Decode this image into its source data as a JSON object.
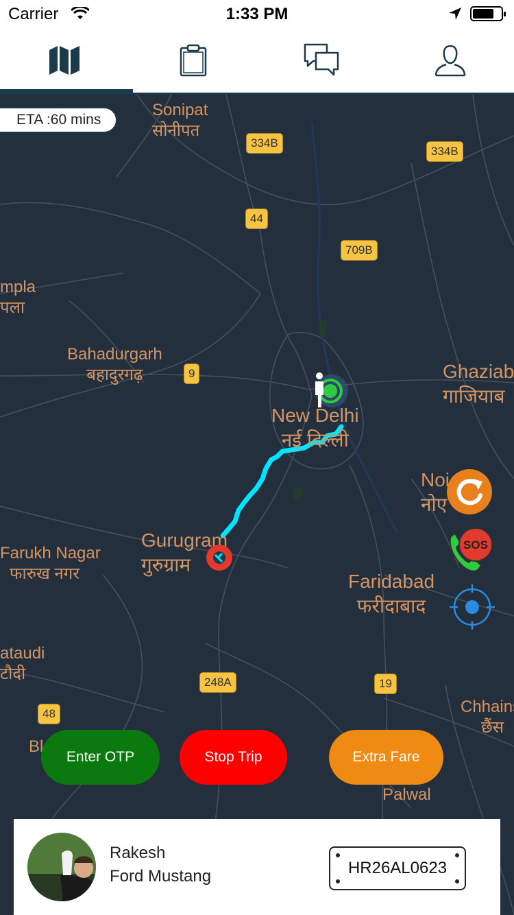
{
  "status_bar": {
    "carrier": "Carrier",
    "time": "1:33 PM"
  },
  "tabs": [
    {
      "icon": "map-icon",
      "selected": true
    },
    {
      "icon": "clipboard-icon",
      "selected": false
    },
    {
      "icon": "chat-icon",
      "selected": false
    },
    {
      "icon": "profile-icon",
      "selected": false
    }
  ],
  "eta": "ETA :60 mins",
  "map": {
    "places": [
      {
        "name": "Sonipat",
        "local": "सोनीपत"
      },
      {
        "name": "mpla",
        "local": "पला"
      },
      {
        "name": "Bahadurgarh",
        "local": "बहादुरगढ़"
      },
      {
        "name": "New Delhi",
        "local": "नई दिल्ली"
      },
      {
        "name": "Ghaziab",
        "local": "गाजियाब"
      },
      {
        "name": "Noi",
        "local": "नोए"
      },
      {
        "name": "Gurugram",
        "local": "गुरुग्राम"
      },
      {
        "name": "Farukh Nagar",
        "local": "फारुख नगर"
      },
      {
        "name": "Faridabad",
        "local": "फरीदाबाद"
      },
      {
        "name": "ataudi",
        "local": "टौदी"
      },
      {
        "name": "Chhains",
        "local": "छैंस"
      },
      {
        "name": "Palwal",
        "local": ""
      },
      {
        "name": "Bl",
        "local": ""
      }
    ],
    "highways": [
      "334B",
      "334B",
      "44",
      "709B",
      "9",
      "248A",
      "19",
      "48"
    ]
  },
  "actions": {
    "enter_otp": "Enter OTP",
    "stop_trip": "Stop Trip",
    "extra_fare": "Extra Fare",
    "sos": "SOS"
  },
  "driver": {
    "name": "Rakesh",
    "car": "Ford Mustang",
    "plate": "HR26AL0623"
  },
  "colors": {
    "map_bg": "#242f3e",
    "route": "#00e5ff",
    "primary": "#1b3b4d",
    "otp": "#0a7a0f",
    "stop": "#ff0000",
    "fare": "#ef8a12"
  }
}
